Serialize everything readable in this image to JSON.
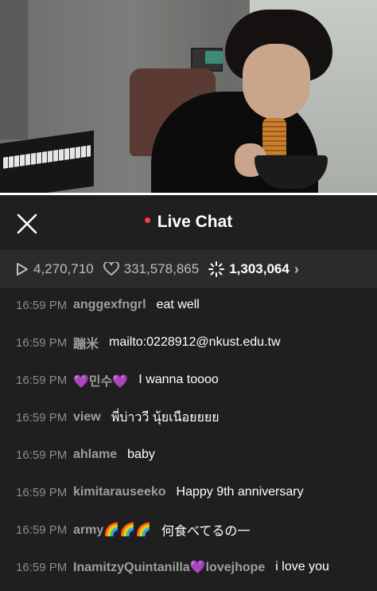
{
  "header": {
    "title": "Live Chat"
  },
  "stats": {
    "plays": "4,270,710",
    "likes": "331,578,865",
    "hearts": "1,303,064"
  },
  "messages": [
    {
      "time": "16:59 PM",
      "user": "anggexfngrl",
      "text": "eat well"
    },
    {
      "time": "16:59 PM",
      "user": "蹦米",
      "text": "mailto:0228912@nkust.edu.tw"
    },
    {
      "time": "16:59 PM",
      "user": "💜민수💜",
      "text": "I wanna toooo"
    },
    {
      "time": "16:59 PM",
      "user": "view",
      "text": "พี่บ่าววี นุ้ยเนือยยยย"
    },
    {
      "time": "16:59 PM",
      "user": "ahlame",
      "text": "baby"
    },
    {
      "time": "16:59 PM",
      "user": "kimitarauseeko",
      "text": "Happy 9th anniversary"
    },
    {
      "time": "16:59 PM",
      "user": "army🌈🌈🌈",
      "text": "何食べてるの一"
    },
    {
      "time": "16:59 PM",
      "user": "InamitzyQuintanilla💜lovejhope",
      "text": "i love you"
    }
  ]
}
